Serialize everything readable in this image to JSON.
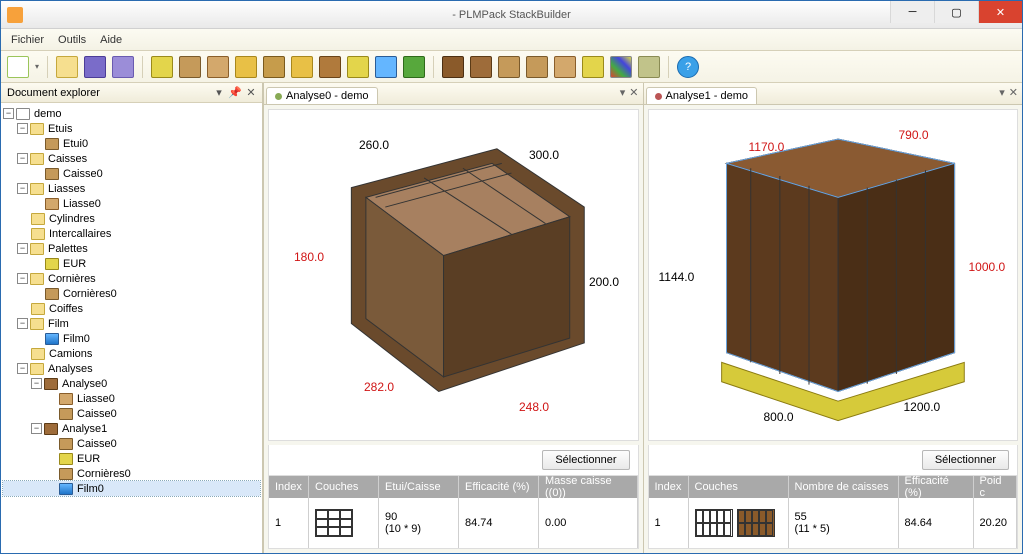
{
  "window": {
    "title": "- PLMPack StackBuilder"
  },
  "menu": {
    "file": "Fichier",
    "tools": "Outils",
    "help": "Aide"
  },
  "panel": {
    "title": "Document explorer"
  },
  "tree": {
    "root": "demo",
    "n0": "Etuis",
    "n0_0": "Etui0",
    "n1": "Caisses",
    "n1_0": "Caisse0",
    "n2": "Liasses",
    "n2_0": "Liasse0",
    "n3": "Cylindres",
    "n4": "Intercallaires",
    "n5": "Palettes",
    "n5_0": "EUR",
    "n6": "Cornières",
    "n6_0": "Cornières0",
    "n7": "Coiffes",
    "n8": "Film",
    "n8_0": "Film0",
    "n9": "Camions",
    "n10": "Analyses",
    "n10_0": "Analyse0",
    "n10_0_0": "Liasse0",
    "n10_0_1": "Caisse0",
    "n10_1": "Analyse1",
    "n10_1_0": "Caisse0",
    "n10_1_1": "EUR",
    "n10_1_2": "Cornières0",
    "n10_1_3": "Film0"
  },
  "views": {
    "a0": {
      "tab": "Analyse0 - demo",
      "select": "Sélectionner",
      "dims": {
        "d1": "260.0",
        "d2": "300.0",
        "d3": "180.0",
        "d4": "200.0",
        "d5": "282.0",
        "d6": "248.0"
      },
      "head": {
        "c1": "Index",
        "c2": "Couches",
        "c3": "Etui/Caisse",
        "c4": "Efficacité (%)",
        "c5": "Masse caisse ((0))"
      },
      "row": {
        "index": "1",
        "etui": "90",
        "etui2": "(10 * 9)",
        "eff": "84.74",
        "mass": "0.00"
      }
    },
    "a1": {
      "tab": "Analyse1 - demo",
      "select": "Sélectionner",
      "dims": {
        "d1": "1170.0",
        "d2": "790.0",
        "d3": "1000.0",
        "d4": "1144.0",
        "d5": "800.0",
        "d6": "1200.0"
      },
      "head": {
        "c1": "Index",
        "c2": "Couches",
        "c3": "Nombre de caisses",
        "c4": "Efficacité (%)",
        "c5": "Poid c"
      },
      "row": {
        "index": "1",
        "nb": "55",
        "nb2": "(11 * 5)",
        "eff": "84.64",
        "poid": "20.20"
      }
    }
  }
}
